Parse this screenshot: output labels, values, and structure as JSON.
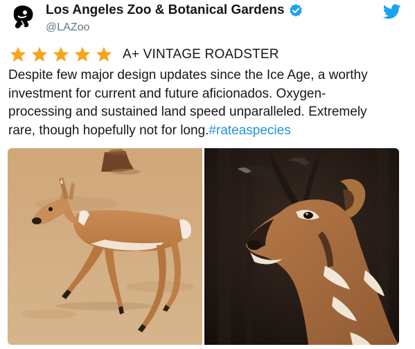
{
  "tweet": {
    "display_name": "Los Angeles Zoo & Botanical Gardens",
    "handle": "@LAZoo",
    "rating": {
      "stars": 5,
      "title": "A+ VINTAGE ROADSTER"
    },
    "body_lines": [
      "Despite few major design updates since the Ice Age, a worthy",
      "investment for current and future aficionados. Oxygen-",
      "processing and sustained land speed unparalleled. Extremely",
      "rare, though hopefully not for long."
    ],
    "hashtag": "#rateaspecies"
  },
  "colors": {
    "verified_badge": "#1da1f2",
    "twitter_brand": "#1da1f2",
    "star": "#f7a41d",
    "hashtag": "#1b95e0",
    "handle": "#657786"
  },
  "icons": {
    "avatar": "zoo-logo-icon",
    "verified": "verified-badge-icon",
    "brand": "twitter-bird-icon",
    "rating": "star-icon"
  },
  "media": [
    {
      "name": "pronghorn-running-photo"
    },
    {
      "name": "pronghorn-closeup-photo"
    }
  ]
}
